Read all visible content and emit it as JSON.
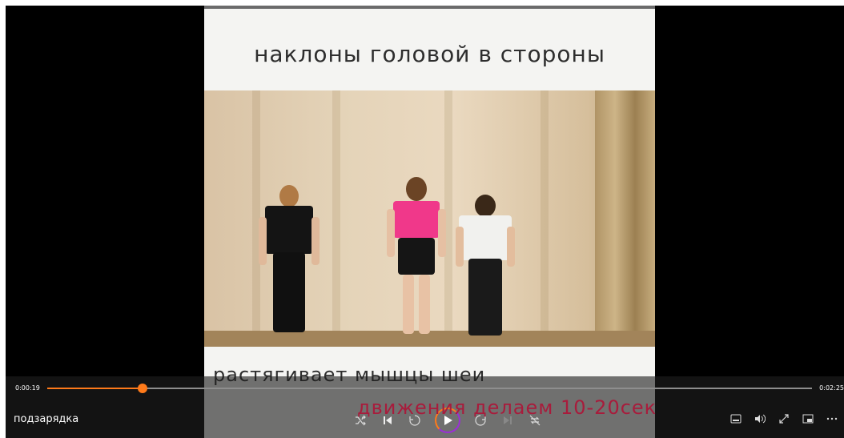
{
  "video": {
    "title_overlay": "наклоны головой в стороны",
    "subtitle_1": "растягивает мышцы шеи",
    "subtitle_2": "движения делаем 10-20сек"
  },
  "player": {
    "title": "подзарядка",
    "current_time": "0:00:19",
    "total_time": "0:02:25",
    "progress": 0.125,
    "colors": {
      "accent": "#ff7a1a",
      "accent2": "#9b2fd6"
    }
  },
  "controls": {
    "center": [
      "shuffle-icon",
      "previous-icon",
      "rewind-10-icon",
      "play-icon",
      "forward-30-icon",
      "next-icon",
      "repeat-off-icon"
    ],
    "right": [
      "subtitles-icon",
      "volume-icon",
      "fullscreen-icon",
      "mini-player-icon",
      "more-icon"
    ]
  }
}
